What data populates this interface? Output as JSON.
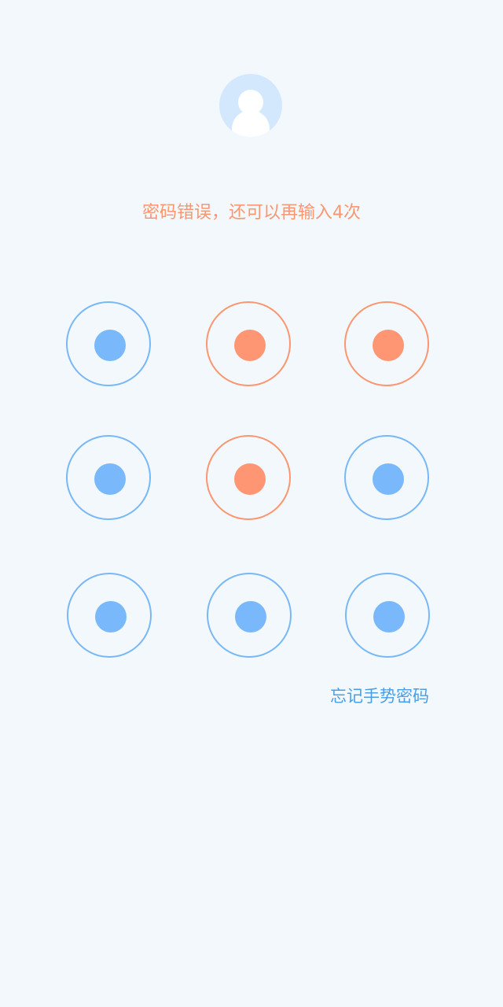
{
  "avatar": {
    "icon": "user-avatar-icon"
  },
  "message": "密码错误，还可以再输入4次",
  "gesture_grid": {
    "rows": 3,
    "cols": 3,
    "nodes": [
      {
        "row": 1,
        "col": 1,
        "state": "normal"
      },
      {
        "row": 1,
        "col": 2,
        "state": "error"
      },
      {
        "row": 1,
        "col": 3,
        "state": "error"
      },
      {
        "row": 2,
        "col": 1,
        "state": "normal"
      },
      {
        "row": 2,
        "col": 2,
        "state": "error"
      },
      {
        "row": 2,
        "col": 3,
        "state": "normal"
      },
      {
        "row": 3,
        "col": 1,
        "state": "normal"
      },
      {
        "row": 3,
        "col": 2,
        "state": "normal"
      },
      {
        "row": 3,
        "col": 3,
        "state": "normal"
      }
    ]
  },
  "forgot_link": "忘记手势密码",
  "colors": {
    "background": "#f2f8fc",
    "normal": "#78b8f6",
    "error": "#fb9670",
    "link": "#4a9ee5",
    "avatar_bg": "#d3e8fd"
  }
}
